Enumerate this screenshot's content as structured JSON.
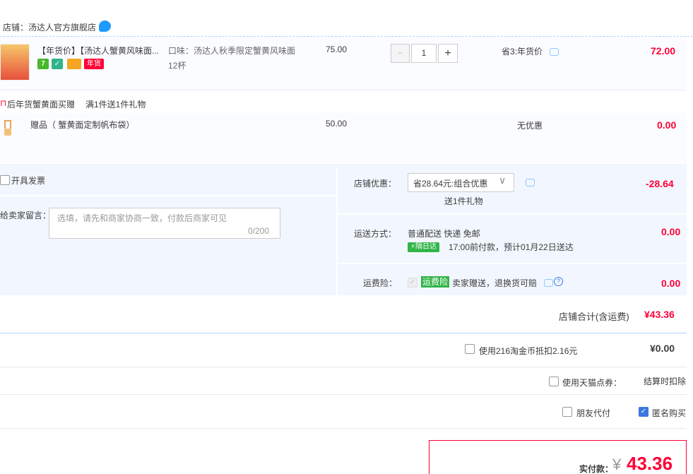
{
  "shop": {
    "label": "店铺：汤达人官方旗舰店"
  },
  "item": {
    "title": "【年货价】【汤达人蟹黄风味面...",
    "flavor_line1": "口味：汤达人秋季限定蟹黄风味面",
    "flavor_line2": "12杯",
    "price": "75.00",
    "quantity": "1",
    "minus": "−",
    "plus": "+",
    "promo": "省3:年货价",
    "subtotal": "72.00",
    "tag_seven": "7",
    "tag_new_year": "年货"
  },
  "gift_promo": {
    "title": "后年货蟹黄面买赠",
    "rule": "满1件送1件礼物"
  },
  "gift": {
    "name": "赠品（ 蟹黄面定制帆布袋）",
    "price": "50.00",
    "promo": "无优惠",
    "subtotal": "0.00"
  },
  "invoice": {
    "label": "开具发票"
  },
  "message": {
    "label": "给卖家留言：",
    "placeholder": "选填，请先和商家协商一致，付款后商家可见",
    "counter": "0/200"
  },
  "shop_discount": {
    "label": "店铺优惠：",
    "selected": "省28.64元:组合优惠",
    "gift_note": "送1件礼物",
    "amount": "-28.64"
  },
  "shipping": {
    "label": "运送方式：",
    "method": "普通配送 快递 免邮",
    "badge": "隔日达",
    "eta": "17:00前付款，预计01月22日送达",
    "amount": "0.00"
  },
  "insurance": {
    "label": "运费险：",
    "badge": "运费险",
    "desc": "卖家赠送，退换货可赔",
    "amount": "0.00"
  },
  "shop_total": {
    "label": "店铺合计(含运费)",
    "amount": "¥43.36"
  },
  "coins": {
    "label": "使用216淘金币抵扣2.16元",
    "amount": "¥0.00"
  },
  "points": {
    "label": "使用天猫点券：",
    "value": "结算时扣除"
  },
  "options": {
    "friend_pay": "朋友代付",
    "anonymous": "匿名购买"
  },
  "payment": {
    "label": "实付款：",
    "currency": "¥",
    "amount": "43.36"
  },
  "colors": {
    "accent_red": "#ff0036",
    "panel_blue": "#f2f7ff",
    "link_blue": "#3b78dd"
  }
}
